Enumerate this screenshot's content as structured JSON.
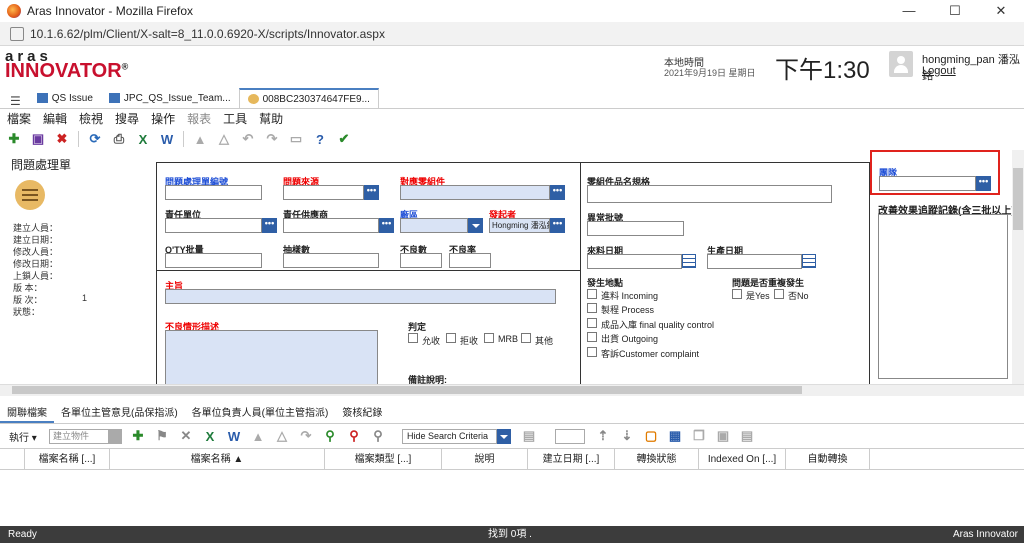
{
  "window": {
    "title": "Aras Innovator - Mozilla Firefox",
    "minimize": "—",
    "maximize": "☐",
    "close": "✕"
  },
  "url": "10.1.6.62/plm/Client/X-salt=8_11.0.0.6920-X/scripts/Innovator.aspx",
  "header": {
    "logo_top": "aras",
    "logo_main": "INNOVATOR",
    "logo_reg": "®",
    "local_time_label": "本地時間",
    "date": "2021年9月19日 星期日",
    "clock": "下午1:30",
    "username": "hongming_pan 潘泓銘",
    "logout": "Logout"
  },
  "tabs": [
    {
      "label": "QS Issue"
    },
    {
      "label": "JPC_QS_Issue_Team..."
    },
    {
      "label": "008BC230374647FE9..."
    }
  ],
  "menu": [
    "檔案",
    "編輯",
    "檢視",
    "搜尋",
    "操作",
    "報表",
    "工具",
    "幫助"
  ],
  "left_panel": {
    "title": "問題處理單",
    "fields": [
      "建立人員：",
      "建立日期：",
      "修改人員：",
      "修改日期：",
      "上鎖人員：",
      "版 本：",
      "版 次：",
      "狀態："
    ],
    "revision_value": "1"
  },
  "form": {
    "issue_no": "問題處理單編號",
    "source": "問題來源",
    "part": "對應零組件",
    "part_spec": "零組件品名規格",
    "owner_unit": "責任單位",
    "owner_supplier": "責任供應商",
    "plant": "廠區",
    "originator": "發起者",
    "originator_value": "Hongming 潘泓銘",
    "qty_lot": "Q'TY批量",
    "sample_qty": "抽樣數",
    "defect_qty": "不良數",
    "defect_rate": "不良率",
    "abnormal_lot": "異常批號",
    "incoming_date": "來料日期",
    "prod_date": "生產日期",
    "subject": "主旨",
    "defect_desc": "不良情形描述",
    "judgement": "判定",
    "judge_options": [
      "允收",
      "拒收",
      "MRB",
      "其他"
    ],
    "remarks": "備註說明:",
    "location": "發生地點",
    "location_options": [
      "進料 Incoming",
      "製程 Process",
      "成品入庫 final quality control",
      "出貨 Outgoing",
      "客訴Customer complaint"
    ],
    "recurrence": "問題是否重複發生",
    "recurrence_options": [
      "是Yes",
      "否No"
    ],
    "team": "團隊",
    "improvement": "改善效果追蹤記錄(含三批以上):",
    "dots": "•••"
  },
  "bottom": {
    "tabs": [
      "關聯檔案",
      "各單位主管意見(品保指派)",
      "各單位負責人員(單位主管指派)",
      "簽核紀錄"
    ],
    "exec": "執行 ▾",
    "create_item": "建立物件",
    "hide_search": "Hide Search Criteria",
    "columns": [
      "檔案名稱 [...]",
      "檔案名稱 ▲",
      "檔案類型 [...]",
      "說明",
      "建立日期 [...]",
      "轉換狀態",
      "Indexed On [...]",
      "自動轉換"
    ]
  },
  "status": {
    "left": "Ready",
    "center": "找到 0項 .",
    "right": "Aras Innovator"
  }
}
